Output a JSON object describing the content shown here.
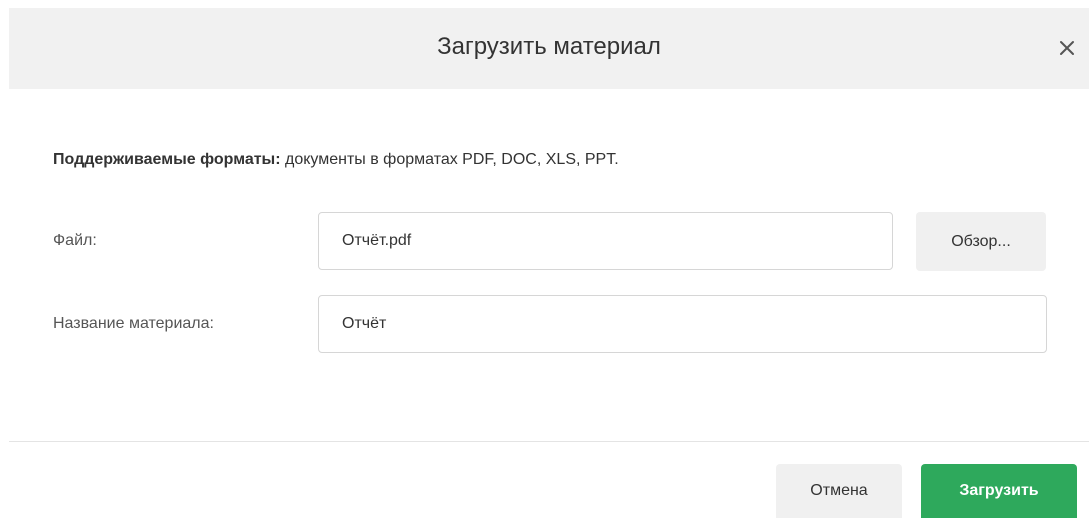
{
  "dialog": {
    "title": "Загрузить материал",
    "close_label": "×"
  },
  "formats": {
    "label": "Поддерживаемые форматы:",
    "text": " документы в форматах PDF, DOC, XLS, PPT."
  },
  "file_field": {
    "label": "Файл:",
    "value": "Отчёт.pdf",
    "browse_label": "Обзор..."
  },
  "name_field": {
    "label": "Название материала:",
    "value": "Отчёт"
  },
  "footer": {
    "cancel_label": "Отмена",
    "upload_label": "Загрузить"
  },
  "colors": {
    "primary": "#2ea95c",
    "header_bg": "#f1f1f1",
    "secondary_button_bg": "#f0f0f0"
  }
}
